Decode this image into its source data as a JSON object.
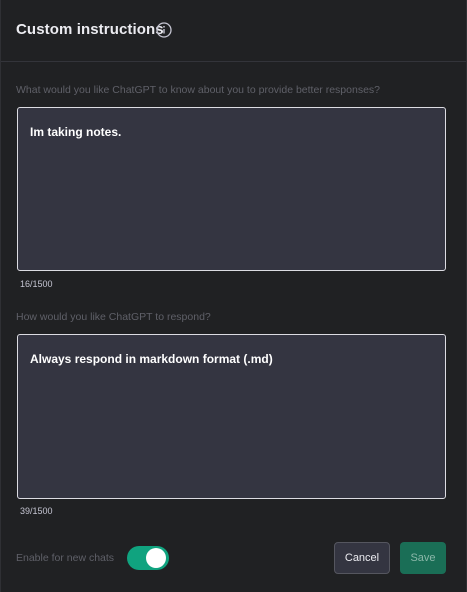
{
  "dialog": {
    "title": "Custom instructions"
  },
  "about_you": {
    "question": "What would you like ChatGPT to know about you to provide better responses?",
    "value": "Im taking notes.",
    "counter": "16/1500"
  },
  "respond": {
    "question": "How would you like ChatGPT to respond?",
    "value": "Always respond in markdown format (.md)",
    "counter": "39/1500"
  },
  "footer": {
    "toggle_label": "Enable for new chats",
    "toggle_on": true,
    "cancel_label": "Cancel",
    "save_label": "Save"
  },
  "icons": {
    "info": "info-icon"
  },
  "colors": {
    "accent": "#10a37f",
    "background": "#202123",
    "input_background": "#343541"
  }
}
